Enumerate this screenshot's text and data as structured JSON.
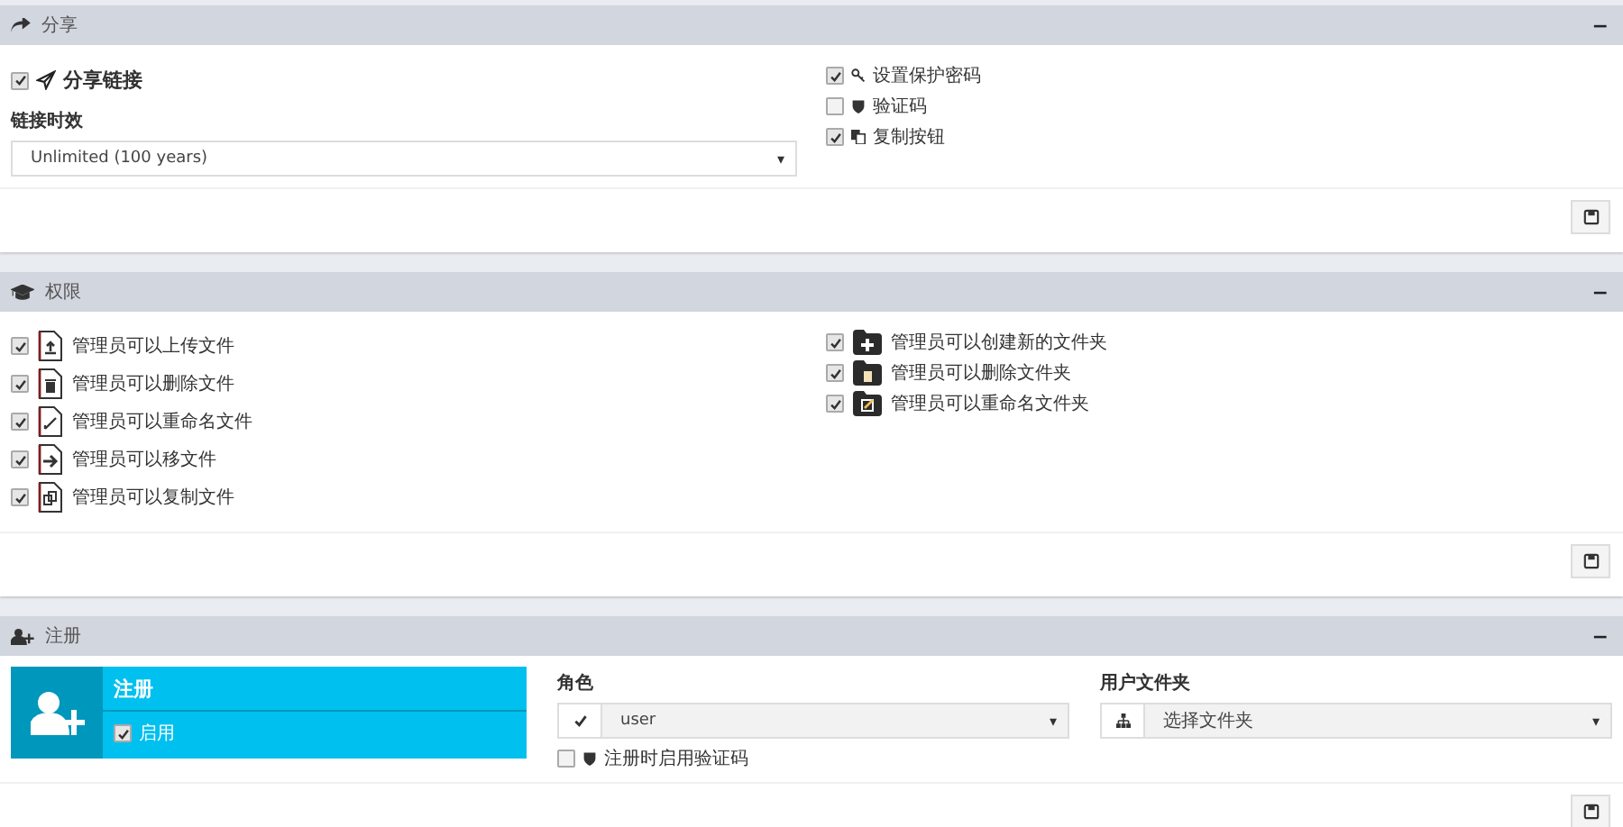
{
  "share": {
    "title": "分享",
    "collapse": "−",
    "enable": {
      "label": "分享链接",
      "checked": true
    },
    "lifetime": {
      "label": "链接时效",
      "value": "Unlimited (100 years)",
      "caret": "▾"
    },
    "options": [
      {
        "kind": "key",
        "label": "设置保护密码",
        "checked": true
      },
      {
        "kind": "shield",
        "label": "验证码",
        "checked": false
      },
      {
        "kind": "copy",
        "label": "复制按钮",
        "checked": true
      }
    ]
  },
  "permissions": {
    "title": "权限",
    "collapse": "−",
    "files": [
      {
        "kind": "upload",
        "label": "管理员可以上传文件",
        "checked": true
      },
      {
        "kind": "delete",
        "label": "管理员可以删除文件",
        "checked": true
      },
      {
        "kind": "rename",
        "label": "管理员可以重命名文件",
        "checked": true
      },
      {
        "kind": "move",
        "label": "管理员可以移文件",
        "checked": true
      },
      {
        "kind": "copy",
        "label": "管理员可以复制文件",
        "checked": true
      }
    ],
    "folders": [
      {
        "kind": "new",
        "label": "管理员可以创建新的文件夹",
        "checked": true
      },
      {
        "kind": "delete",
        "label": "管理员可以删除文件夹",
        "checked": true
      },
      {
        "kind": "rename",
        "label": "管理员可以重命名文件夹",
        "checked": true
      }
    ]
  },
  "registration": {
    "title": "注册",
    "collapse": "−",
    "card": {
      "title": "注册",
      "enable": {
        "label": "启用",
        "checked": true
      }
    },
    "role": {
      "label": "角色",
      "value": "user",
      "caret": "▾"
    },
    "captcha": {
      "label": "注册时启用验证码",
      "checked": false
    },
    "folder": {
      "label": "用户文件夹",
      "placeholder": "选择文件夹",
      "caret": "▾"
    }
  }
}
